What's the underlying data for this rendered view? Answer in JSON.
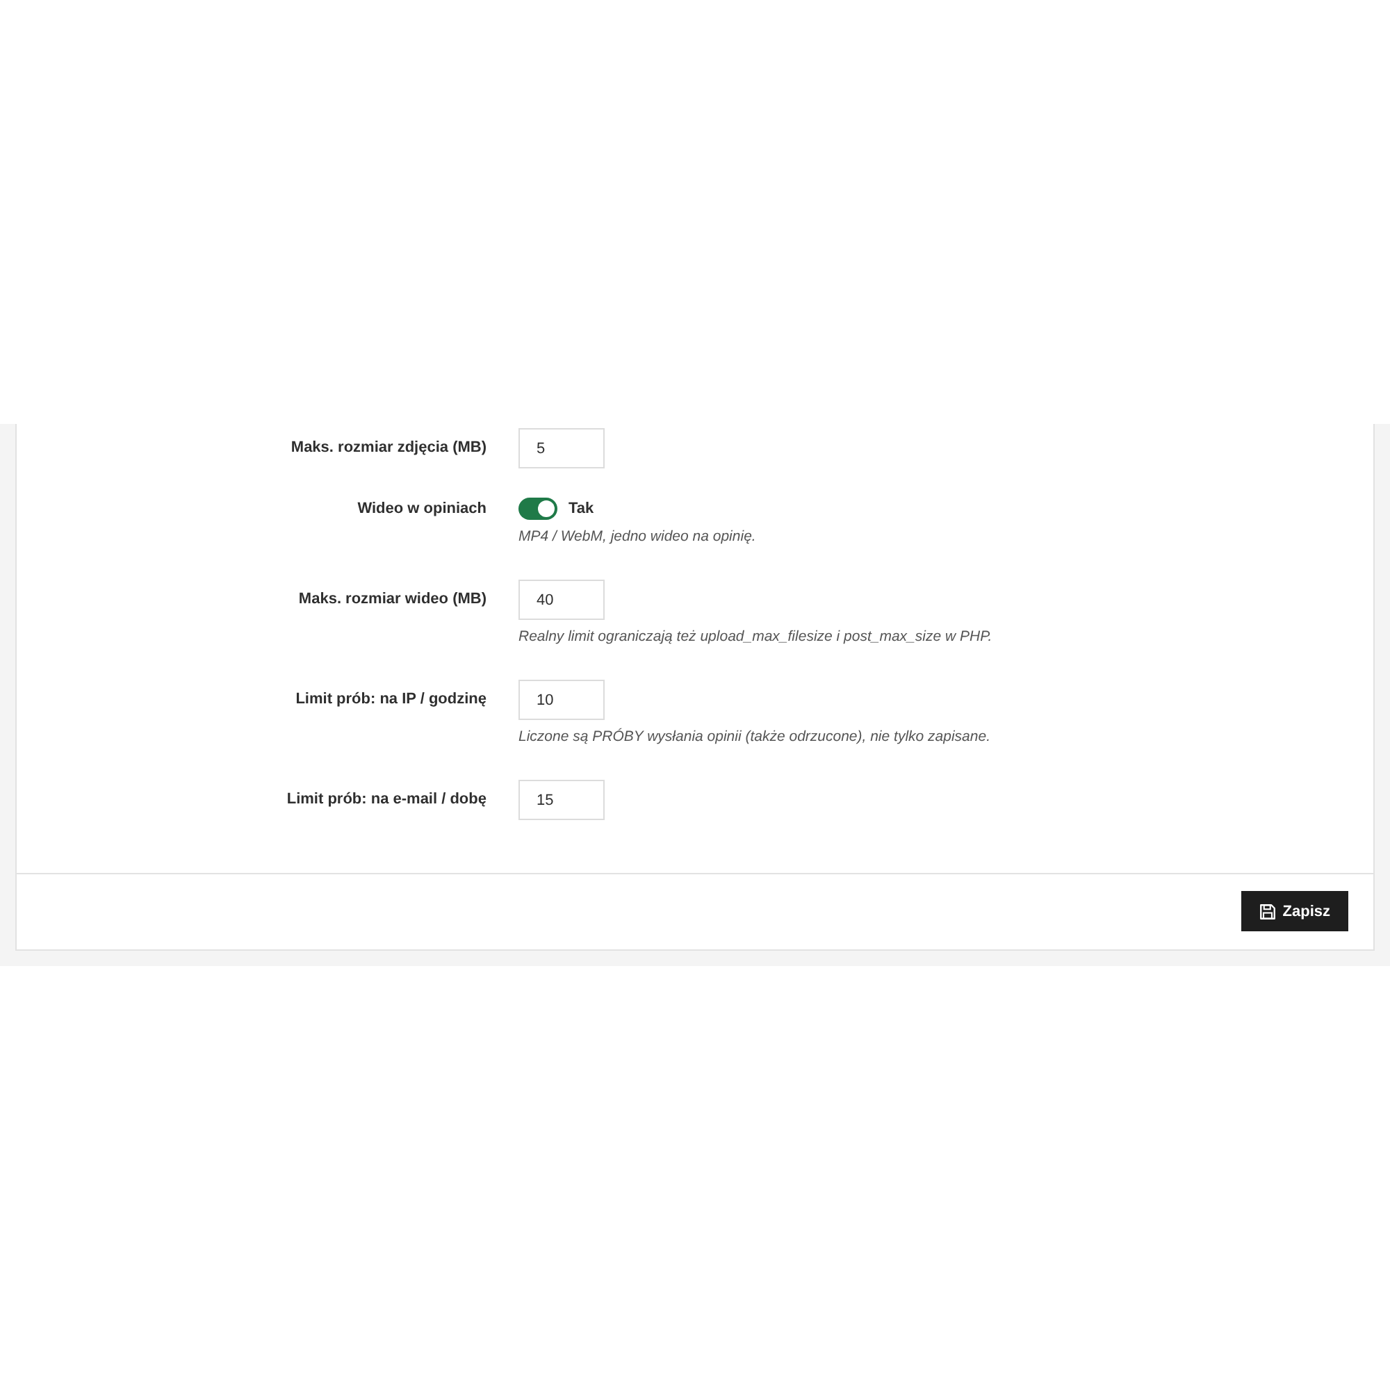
{
  "settings": [
    {
      "kind": "number",
      "label": "Maks. rozmiar zdjęcia (MB)",
      "value": "5"
    },
    {
      "kind": "toggle",
      "label": "Wideo w opiniach",
      "on": true,
      "toggle_label": "Tak",
      "help": "MP4 / WebM, jedno wideo na opinię."
    },
    {
      "kind": "number",
      "label": "Maks. rozmiar wideo (MB)",
      "value": "40",
      "help": "Realny limit ograniczają też upload_max_filesize i post_max_size w PHP."
    },
    {
      "kind": "number",
      "label": "Limit prób: na IP / godzinę",
      "value": "10",
      "help": "Liczone są PRÓBY wysłania opinii (także odrzucone), nie tylko zapisane."
    },
    {
      "kind": "number",
      "label": "Limit prób: na e-mail / dobę",
      "value": "15"
    }
  ],
  "footer": {
    "save_button": "Zapisz"
  }
}
